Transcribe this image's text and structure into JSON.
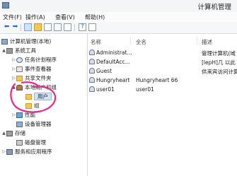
{
  "window": {
    "title": "计算机管理"
  },
  "menu": [
    "文件(F)",
    "操作(A)",
    "查看(V)",
    "帮助(H)"
  ],
  "tree": [
    {
      "id": "root",
      "label": "计算机管理(本地)",
      "icon": "computer-icon",
      "arrow": "▲"
    },
    {
      "id": "systools",
      "label": "系统工具",
      "icon": "tools-icon",
      "arrow": "▲"
    },
    {
      "id": "tasks",
      "label": "任务计划程序",
      "icon": "clock-icon",
      "arrow": "▷"
    },
    {
      "id": "events",
      "label": "事件查看器",
      "icon": "event-log-icon",
      "arrow": "▷"
    },
    {
      "id": "shares",
      "label": "共享文件夹",
      "icon": "shared-folder-icon",
      "arrow": "▷"
    },
    {
      "id": "lusers",
      "label": "本地用户和组",
      "icon": "users-icon",
      "arrow": "▲"
    },
    {
      "id": "users",
      "label": "用户",
      "icon": "folder-icon",
      "arrow": ""
    },
    {
      "id": "groups",
      "label": "组",
      "icon": "folder-icon",
      "arrow": ""
    },
    {
      "id": "perf",
      "label": "性能",
      "icon": "performance-icon",
      "arrow": "▷"
    },
    {
      "id": "devmgr",
      "label": "设备管理器",
      "icon": "device-manager-icon",
      "arrow": ""
    },
    {
      "id": "storage",
      "label": "存储",
      "icon": "storage-icon",
      "arrow": "▲"
    },
    {
      "id": "diskmgmt",
      "label": "磁盘管理",
      "icon": "disk-icon",
      "arrow": ""
    },
    {
      "id": "services",
      "label": "服务和应用程序",
      "icon": "services-icon",
      "arrow": "▷"
    }
  ],
  "list": {
    "headers": [
      "名称",
      "全名",
      "描述"
    ],
    "rows": [
      {
        "name": "Administrat...",
        "fullname": "",
        "desc": "管理计算机(域"
      },
      {
        "name": "DefaultAcc...",
        "fullname": "",
        "desc": "[lepH]几 以此"
      },
      {
        "name": "Guest",
        "fullname": "",
        "desc": "供来宾访问计算"
      },
      {
        "name": "Hungryheart",
        "fullname": "Hungryheart 66",
        "desc": ""
      },
      {
        "name": "user01",
        "fullname": "user01",
        "desc": ""
      }
    ]
  },
  "colors": {
    "selection": "#cfe3fb",
    "annotation": "#e6288f",
    "folder": "#f1c75a"
  }
}
